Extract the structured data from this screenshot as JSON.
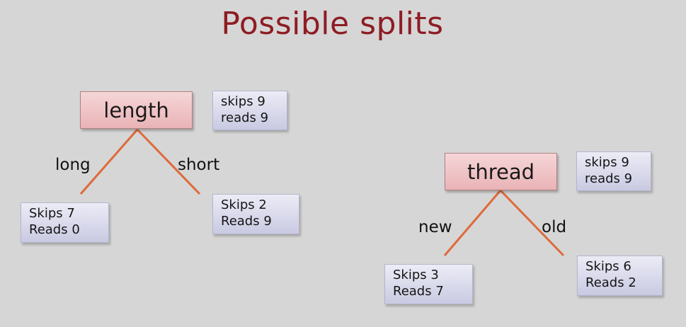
{
  "title": "Possible splits",
  "trees": [
    {
      "root": {
        "label": "length",
        "stats": [
          "skips 9",
          "reads 9"
        ]
      },
      "branches": [
        {
          "label": "long",
          "stats": [
            "Skips 7",
            "Reads 0"
          ]
        },
        {
          "label": "short",
          "stats": [
            "Skips 2",
            "Reads 9"
          ]
        }
      ]
    },
    {
      "root": {
        "label": "thread",
        "stats": [
          "skips 9",
          "reads 9"
        ]
      },
      "branches": [
        {
          "label": "new",
          "stats": [
            "Skips 3",
            "Reads 7"
          ]
        },
        {
          "label": "old",
          "stats": [
            "Skips 6",
            "Reads 2"
          ]
        }
      ]
    }
  ],
  "colors": {
    "title": "#8e1c24",
    "edge_line": "#de6a3a",
    "node_fill": "#eec3c5",
    "stat_fill": "#d9dae9",
    "background": "#d6d6d6"
  }
}
